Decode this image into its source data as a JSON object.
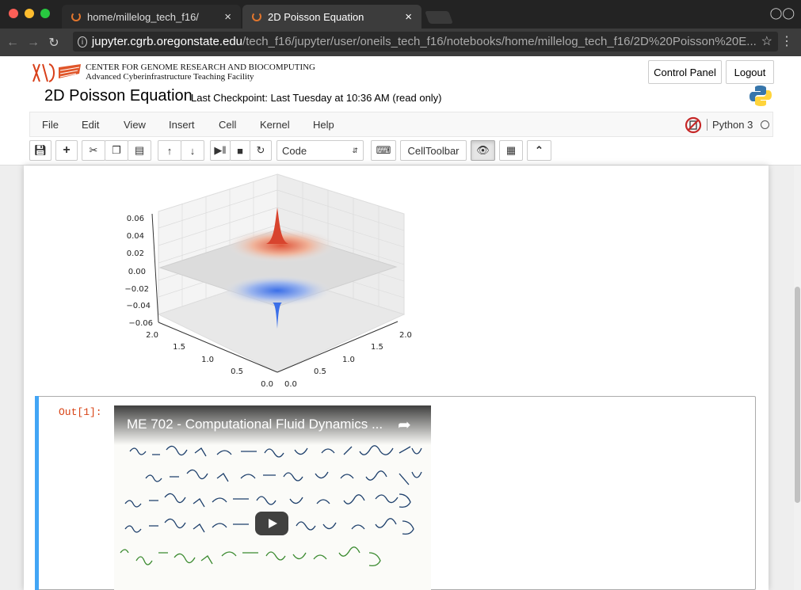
{
  "browser": {
    "tabs": [
      {
        "label": "home/millelog_tech_f16/"
      },
      {
        "label": "2D Poisson Equation"
      }
    ],
    "url_host": "jupyter.cgrb.oregonstate.edu",
    "url_path": "/tech_f16/jupyter/user/oneils_tech_f16/notebooks/home/millelog_tech_f16/2D%20Poisson%20E..."
  },
  "header": {
    "org_line1": "CENTER FOR GENOME RESEARCH AND BIOCOMPUTING",
    "org_line2": "Advanced Cyberinfrastructure Teaching Facility",
    "control_panel": "Control Panel",
    "logout": "Logout",
    "notebook_title": "2D Poisson Equation",
    "checkpoint": "Last Checkpoint: Last Tuesday at 10:36 AM (read only)"
  },
  "menu": [
    "File",
    "Edit",
    "View",
    "Insert",
    "Cell",
    "Kernel",
    "Help"
  ],
  "kernel": {
    "name": "Python 3"
  },
  "toolbar": {
    "cell_type": "Code",
    "celltoolbar": "CellToolbar"
  },
  "plot": {
    "z_ticks": [
      "0.06",
      "0.04",
      "0.02",
      "0.00",
      "−0.02",
      "−0.04",
      "−0.06"
    ],
    "left_ticks": [
      "2.0",
      "1.5",
      "1.0",
      "0.5",
      "0.0"
    ],
    "right_ticks": [
      "0.0",
      "0.5",
      "1.0",
      "1.5",
      "2.0"
    ]
  },
  "output": {
    "prompt": "Out[1]:",
    "video_title": "ME 702 - Computational Fluid Dynamics ..."
  },
  "colors": {
    "accent": "#42a5f5",
    "prompt": "#d84315",
    "spinner": "#e2762d"
  }
}
